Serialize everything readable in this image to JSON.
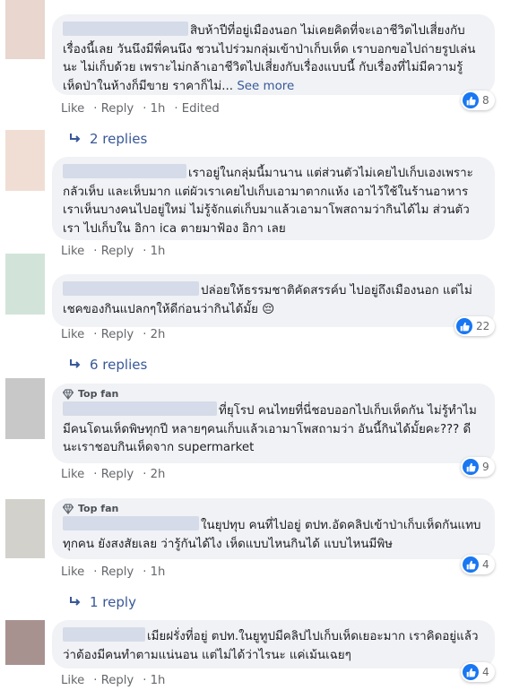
{
  "comments": [
    {
      "text": "สิบห้าปีที่อยู่เมืองนอก ไม่เคยคิดที่จะเอาชีวิตไปเสี่ยงกับเรื่องนี้เลย วันนึงมีพี่คนนึง ชวนไปร่วมกลุ่มเข้าป่าเก็บเห็ด เราบอกขอไปถ่ายรูปเล่นนะ ไม่เก็บด้วย เพราะไม่กล้าเอาชีวิตไปเสี่ยงกับเรื่องแบบนี้ กับเรื่องที่ไม่มีความรู้ เห็ดป่าในห้างก็มีขาย ราคาก็ไม่...",
      "see_more": "See more",
      "like": "Like",
      "reply": "Reply",
      "time": "1h",
      "edited": "Edited",
      "reaction_count": "8",
      "avatar_color": "#e8d6cf"
    },
    {
      "text": "เราอยู่ในกลุ่มนี้มานาน แต่ส่วนตัวไม่เคยไปเก็บเองเพราะกลัวเห็บ และเห็บมาก แต่ผัวเราเคยไปเก็บเอามาตากแห้ง เอาไว้ใช้ในร้านอาหาร เราเห็นบางคนไปอยู่ใหม่ ไม่รู้จักแต่เก็บมาแล้วเอามาโพสถามว่ากินได้ไม ส่วนตัวเรา ไปเก็บใน อิกา ica ตายมาฟ้อง อิกา เลย",
      "like": "Like",
      "reply": "Reply",
      "time": "1h",
      "avatar_color": "#f0ded5"
    },
    {
      "text": "ปล่อยให้ธรรมชาติคัดสรรค์บ ไปอยู่ถึงเมืองนอก แต่ไม่เชคของกินแปลกๆให้ดีก่อนว่ากินได้มั้ย 😔",
      "like": "Like",
      "reply": "Reply",
      "time": "2h",
      "reaction_count": "22",
      "avatar_color": "#d2e4d9"
    },
    {
      "badge": "Top fan",
      "text": "ที่ยุโรป คนไทยที่นี่ชอบออกไปเก็บเห็ดกัน ไม่รู้ทำไม มีคนโดนเห็ดพิษทุกปี หลายๆคนเก็บแล้วเอามาโพสถามว่า อันนี้กินได้มั้ยคะ??? ดีนะเราชอบกินเห็ดจาก supermarket",
      "like": "Like",
      "reply": "Reply",
      "time": "2h",
      "reaction_count": "9",
      "avatar_color": "#c8c8c8"
    },
    {
      "badge": "Top fan",
      "text": "ในยุปทุบ คนที่ไปอยู่ ตปท.อัดคลิปเข้าป่าเก็บเห็ดกันแทบทุกคน ยังสงสัยเลย ว่ารู้กันได้ไง เห็ดแบบไหนกินได้ แบบไหนมีพิษ",
      "like": "Like",
      "reply": "Reply",
      "time": "1h",
      "reaction_count": "4",
      "avatar_color": "#d3d1cc"
    },
    {
      "text": "เมียฝรั่งที่อยู่ ตปท.ในยูทูปมีคลิปไปเก็บเห็ดเยอะมาก เราคิดอยู่แล้วว่าต้องมีคนทำตามแน่นอน แต่ไม่ได้ว่าไรนะ แค่เม้นเฉยๆ",
      "like": "Like",
      "reply": "Reply",
      "time": "1h",
      "reaction_count": "4",
      "avatar_color": "#a89290"
    }
  ],
  "reply_threads": [
    {
      "label": "2 replies"
    },
    {
      "label": "6 replies"
    },
    {
      "label": "1 reply"
    }
  ],
  "colors": {
    "link": "#385898",
    "like_blue": "#1877f2",
    "bubble": "#f0f2f5",
    "meta": "#65676b"
  },
  "icons": {
    "like": "thumbs-up-icon",
    "reply_arrow": "reply-arrow-icon",
    "top_fan": "diamond-icon"
  }
}
